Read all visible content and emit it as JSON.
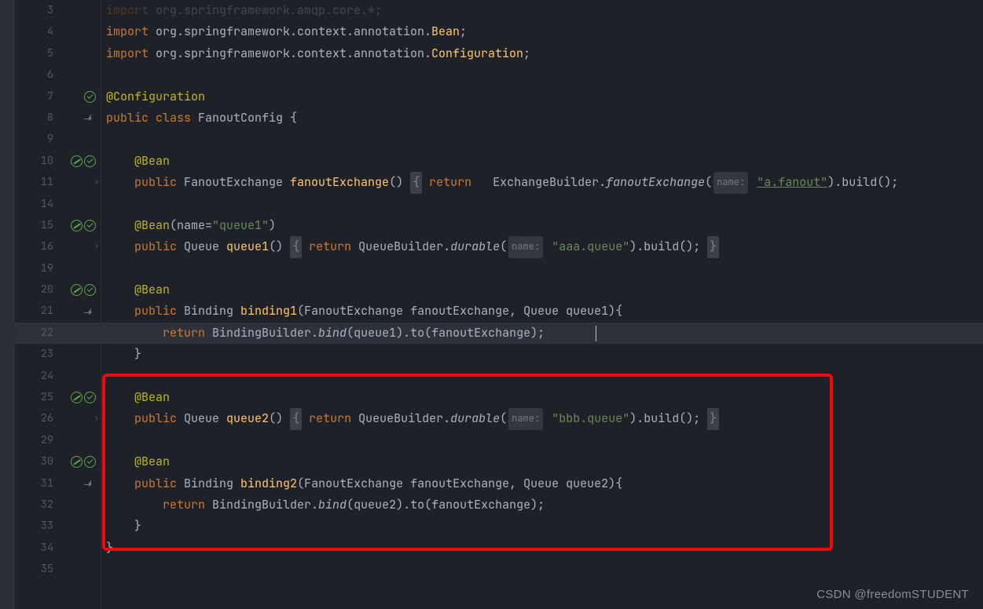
{
  "watermark": "CSDN @freedomSTUDENT",
  "gutter": {
    "lines": [
      "3",
      "4",
      "5",
      "6",
      "7",
      "8",
      "9",
      "10",
      "11",
      "14",
      "15",
      "16",
      "19",
      "20",
      "21",
      "22",
      "23",
      "24",
      "25",
      "26",
      "29",
      "30",
      "31",
      "32",
      "33",
      "34",
      "35"
    ]
  },
  "code": {
    "l3a": "import",
    "l3b": " org.springframework.amqp.core.*;",
    "l4a": "import",
    "l4b": " org.springframework.context.annotation.",
    "l4c": "Bean",
    "l4d": ";",
    "l5a": "import",
    "l5b": " org.springframework.context.annotation.",
    "l5c": "Configuration",
    "l5d": ";",
    "l7a": "@Configuration",
    "l8a": "public ",
    "l8b": "class ",
    "l8c": "FanoutConfig ",
    "l8d": "{",
    "l10a": "    @Bean",
    "l11a": "    ",
    "l11b": "public ",
    "l11c": "FanoutExchange ",
    "l11d": "fanoutExchange",
    "l11e": "() ",
    "l11f": "{",
    "l11g": " return",
    "l11h": "   ExchangeBuilder.",
    "l11i": "fanoutExchange",
    "l11j": "(",
    "l11k": "name:",
    "l11l": " ",
    "l11m": "\"a.fanout\"",
    "l11n": ").build();",
    "l15a": "    @Bean",
    "l15b": "(name=",
    "l15c": "\"queue1\"",
    "l15d": ")",
    "l16a": "    ",
    "l16b": "public ",
    "l16c": "Queue ",
    "l16d": "queue1",
    "l16e": "() ",
    "l16f": "{",
    "l16g": " return ",
    "l16h": "QueueBuilder.",
    "l16i": "durable",
    "l16j": "(",
    "l16k": "name:",
    "l16l": " ",
    "l16m": "\"aaa.queue\"",
    "l16n": ").build(); ",
    "l16o": "}",
    "l20a": "    @Bean",
    "l21a": "    ",
    "l21b": "public ",
    "l21c": "Binding ",
    "l21d": "binding1",
    "l21e": "(FanoutExchange fanoutExchange, Queue queue1){",
    "l22a": "        ",
    "l22b": "return ",
    "l22c": "BindingBuilder.",
    "l22d": "bind",
    "l22e": "(queue1).to(fanoutExchange);",
    "l23a": "    }",
    "l25a": "    @Bean",
    "l26a": "    ",
    "l26b": "public ",
    "l26c": "Queue ",
    "l26d": "queue2",
    "l26e": "() ",
    "l26f": "{",
    "l26g": " return ",
    "l26h": "QueueBuilder.",
    "l26i": "durable",
    "l26j": "(",
    "l26k": "name:",
    "l26l": " ",
    "l26m": "\"bbb.queue\"",
    "l26n": ").build(); ",
    "l26o": "}",
    "l30a": "    @Bean",
    "l31a": "    ",
    "l31b": "public ",
    "l31c": "Binding ",
    "l31d": "binding2",
    "l31e": "(FanoutExchange fanoutExchange, Queue queue2){",
    "l32a": "        ",
    "l32b": "return ",
    "l32c": "BindingBuilder.",
    "l32d": "bind",
    "l32e": "(queue2).to(fanoutExchange);",
    "l33a": "    }",
    "l34a": "}"
  }
}
